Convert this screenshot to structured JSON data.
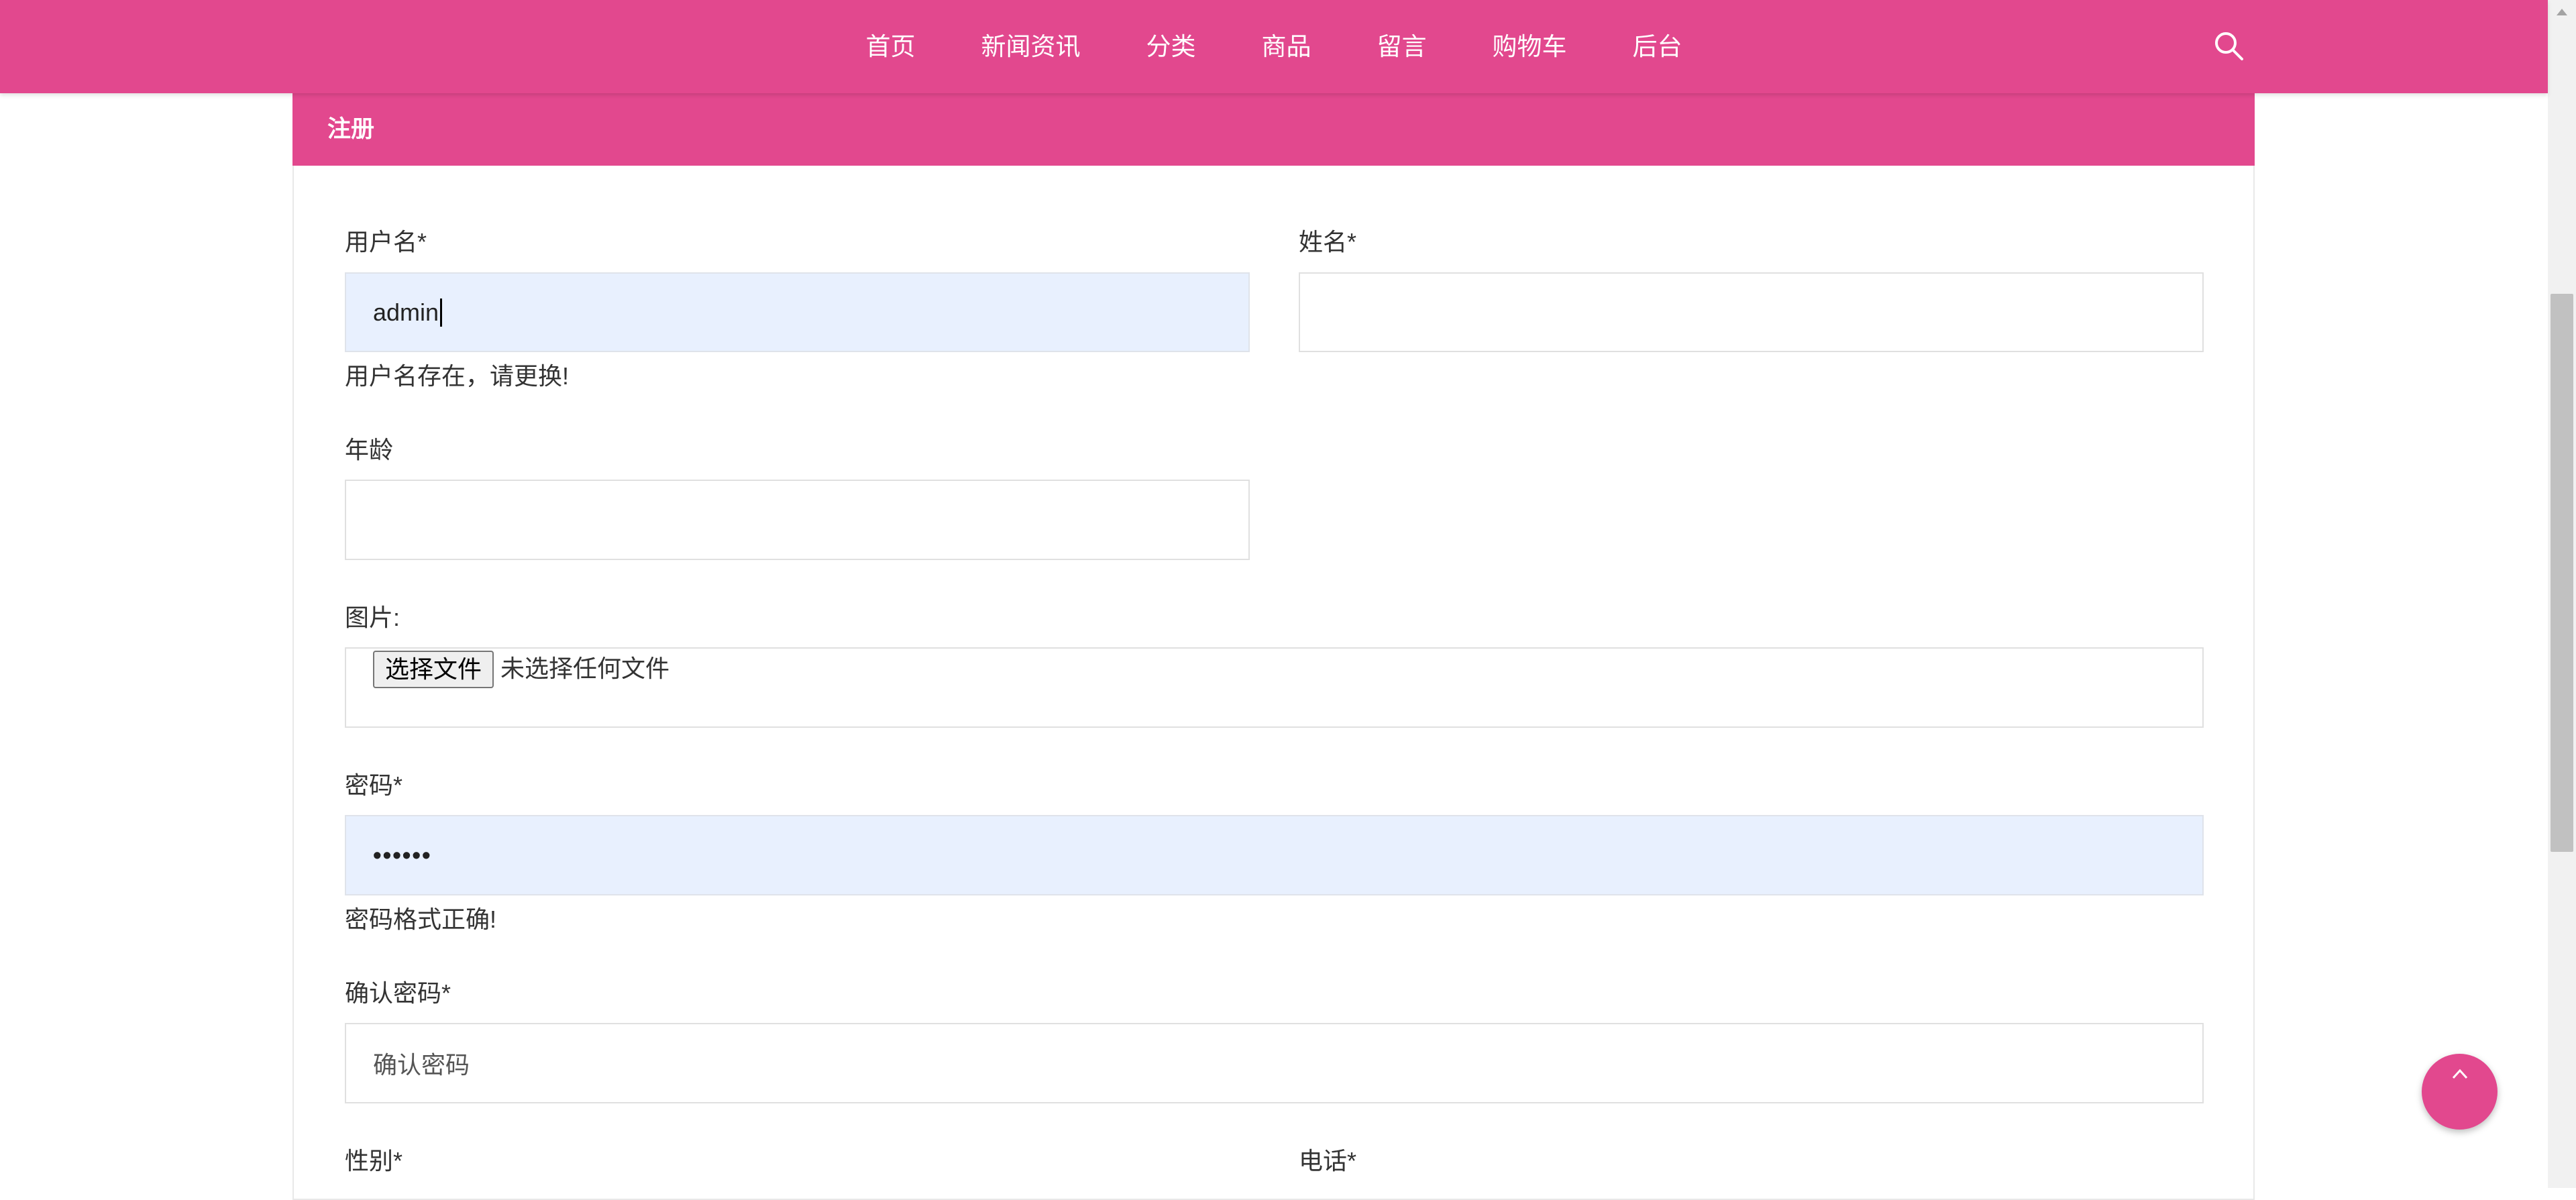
{
  "nav": {
    "items": [
      "首页",
      "新闻资讯",
      "分类",
      "商品",
      "留言",
      "购物车",
      "后台"
    ],
    "search_icon": "search-icon"
  },
  "panel": {
    "title": "注册"
  },
  "form": {
    "username": {
      "label": "用户名*",
      "value": "admin",
      "hint": "用户名存在，请更换!"
    },
    "realname": {
      "label": "姓名*",
      "value": ""
    },
    "age": {
      "label": "年龄",
      "value": ""
    },
    "image": {
      "label": "图片:",
      "button": "选择文件",
      "status": "未选择任何文件"
    },
    "password": {
      "label": "密码*",
      "value": "••••••",
      "hint": "密码格式正确!"
    },
    "confirm_password": {
      "label": "确认密码*",
      "placeholder": "确认密码"
    },
    "gender": {
      "label": "性别*"
    },
    "phone": {
      "label": "电话*"
    }
  },
  "colors": {
    "accent": "#e2488e",
    "autofill": "#e8f0fe"
  },
  "back_to_top_icon": "chevron-up-icon"
}
